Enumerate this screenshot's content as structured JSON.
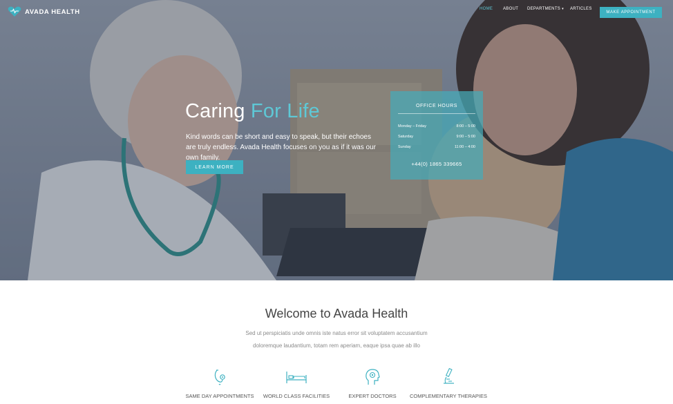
{
  "brand": {
    "name": "AVADA HEALTH",
    "accent_color": "#3db1c1",
    "logo_icon": "heart-icon"
  },
  "nav": {
    "items": [
      {
        "label": "HOME",
        "active": true
      },
      {
        "label": "ABOUT",
        "active": false
      },
      {
        "label": "DEPARTMENTS",
        "active": false,
        "has_dropdown": true
      },
      {
        "label": "ARTICLES",
        "active": false
      }
    ],
    "cta_label": "MAKE APPOINTMENT"
  },
  "hero": {
    "title_main": "Caring",
    "title_accent": "For Life",
    "description": "Kind words can be short and easy to speak, but their echoes are truly endless. Avada Health focuses on you as if it was our own family.",
    "button_label": "LEARN MORE"
  },
  "office_hours": {
    "title": "OFFICE HOURS",
    "rows": [
      {
        "day": "Monday – Friday",
        "time": "8:00 – 5:00"
      },
      {
        "day": "Saturday",
        "time": "9:00 – 5:00"
      },
      {
        "day": "Sunday",
        "time": "11:00 – 4:00"
      }
    ],
    "phone": "+44(0) 1865 339665"
  },
  "welcome": {
    "title": "Welcome to Avada Health",
    "text_line1": "Sed ut perspiciatis unde omnis iste natus error sit voluptatem accusantium",
    "text_line2": "doloremque laudantium, totam rem aperiam, eaque ipsa quae ab illo"
  },
  "features": [
    {
      "label": "SAME DAY APPOINTMENTS",
      "icon": "stethoscope-icon"
    },
    {
      "label": "WORLD CLASS FACILITIES",
      "icon": "hospital-bed-icon"
    },
    {
      "label": "EXPERT DOCTORS",
      "icon": "head-profile-icon"
    },
    {
      "label": "COMPLEMENTARY THERAPIES",
      "icon": "microscope-icon"
    }
  ]
}
